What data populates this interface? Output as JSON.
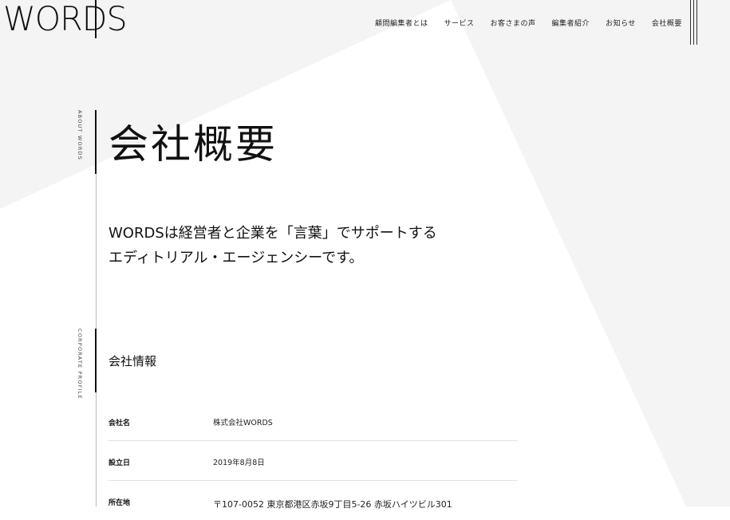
{
  "header": {
    "logo": "WORDS",
    "nav": [
      {
        "label": "顧問編集者とは"
      },
      {
        "label": "サービス"
      },
      {
        "label": "お客さまの声"
      },
      {
        "label": "編集者紹介"
      },
      {
        "label": "お知らせ"
      },
      {
        "label": "会社概要"
      }
    ]
  },
  "sections": {
    "about_label": "ABOUT WORDS",
    "profile_label": "CORPORATE PROFILE"
  },
  "page": {
    "title": "会社概要",
    "lead_line1": "WORDSは経営者と企業を「言葉」でサポートする",
    "lead_line2": "エディトリアル・エージェンシーです。"
  },
  "company": {
    "heading": "会社情報",
    "rows": [
      {
        "label": "会社名",
        "value": "株式会社WORDS"
      },
      {
        "label": "設立日",
        "value": "2019年8月8日"
      },
      {
        "label": "所在地",
        "value": "〒107-0052 東京都港区赤坂9丁目5-26 赤坂ハイツビル301"
      }
    ]
  },
  "colors": {
    "background_shape": "#f4f4f4",
    "page": "#ffffff",
    "text": "#111111",
    "divider": "#e1e1e1"
  }
}
